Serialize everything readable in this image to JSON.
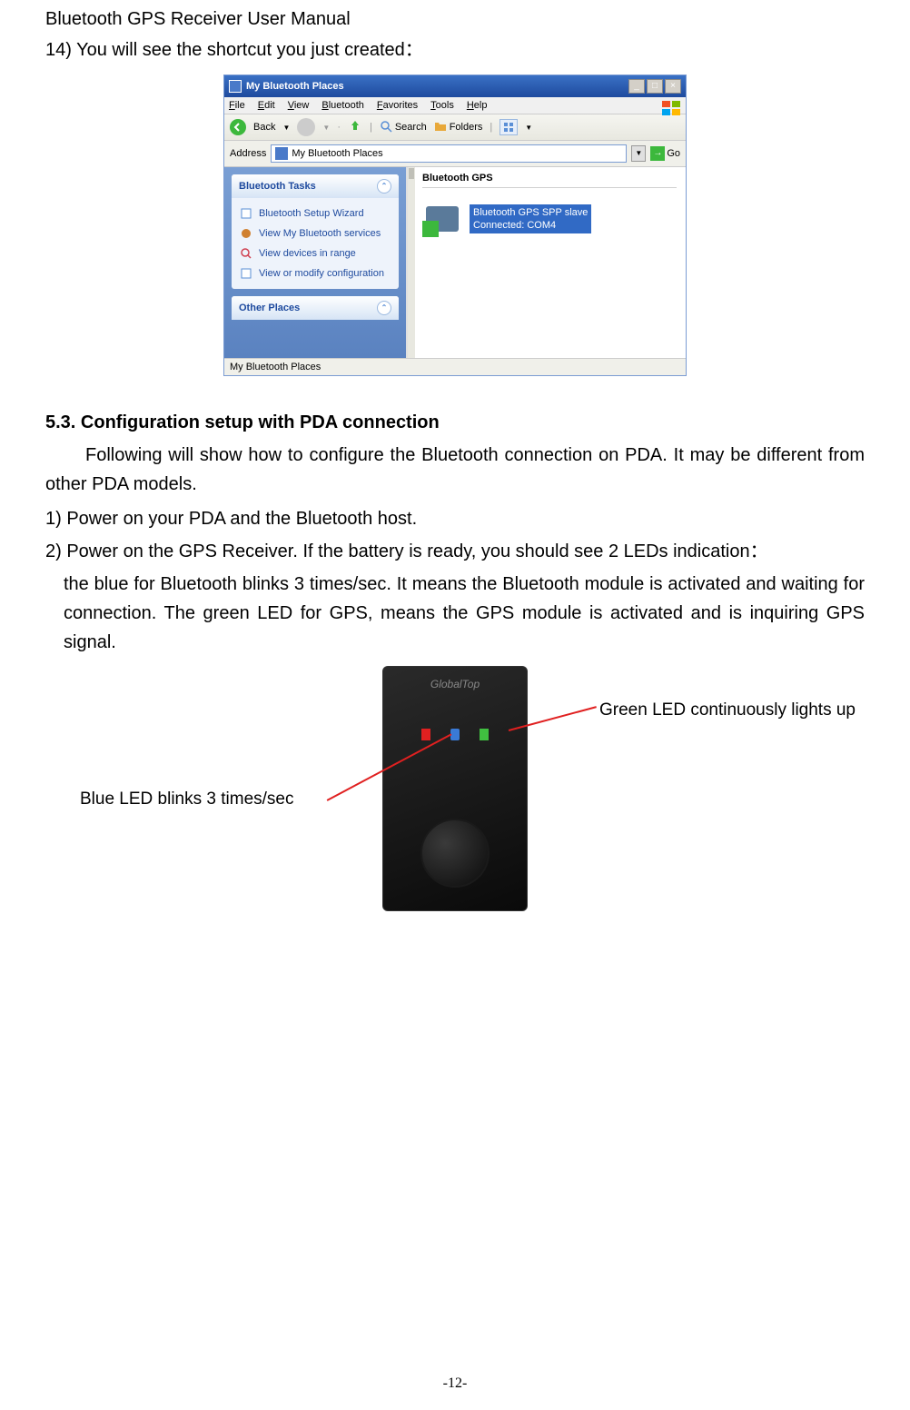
{
  "header": {
    "title": "Bluetooth GPS Receiver User Manual",
    "step14": "14) You will see the shortcut you just created："
  },
  "window": {
    "title": "My Bluetooth Places",
    "menus": [
      "File",
      "Edit",
      "View",
      "Bluetooth",
      "Favorites",
      "Tools",
      "Help"
    ],
    "toolbar": {
      "back": "Back",
      "search": "Search",
      "folders": "Folders"
    },
    "address": {
      "label": "Address",
      "value": "My Bluetooth Places",
      "go": "Go"
    },
    "sidebar": {
      "panel1": {
        "title": "Bluetooth Tasks",
        "items": [
          "Bluetooth Setup Wizard",
          "View My Bluetooth services",
          "View devices in range",
          "View or modify configuration"
        ]
      },
      "panel2": {
        "title": "Other Places"
      }
    },
    "content": {
      "heading": "Bluetooth GPS",
      "device_line1": "Bluetooth GPS SPP slave",
      "device_line2": "Connected: COM4"
    },
    "statusbar": "My Bluetooth Places"
  },
  "section": {
    "heading": "5.3. Configuration setup with PDA connection",
    "intro": "Following will show how to configure the Bluetooth connection on PDA. It may be different from other PDA models.",
    "step1": "1) Power on your PDA and the Bluetooth host.",
    "step2_start": "2) Power on the GPS Receiver. If the battery is ready, you should see 2 LEDs indication：",
    "step2_body": "the blue for Bluetooth blinks 3 times/sec. It means the Bluetooth module is activated and waiting for connection. The green LED for GPS, means the GPS module is activated and is inquiring GPS signal."
  },
  "device": {
    "brand": "GlobalTop",
    "callout_green": "Green LED continuously lights up",
    "callout_blue": "Blue LED blinks 3 times/sec"
  },
  "page_number": "-12-"
}
